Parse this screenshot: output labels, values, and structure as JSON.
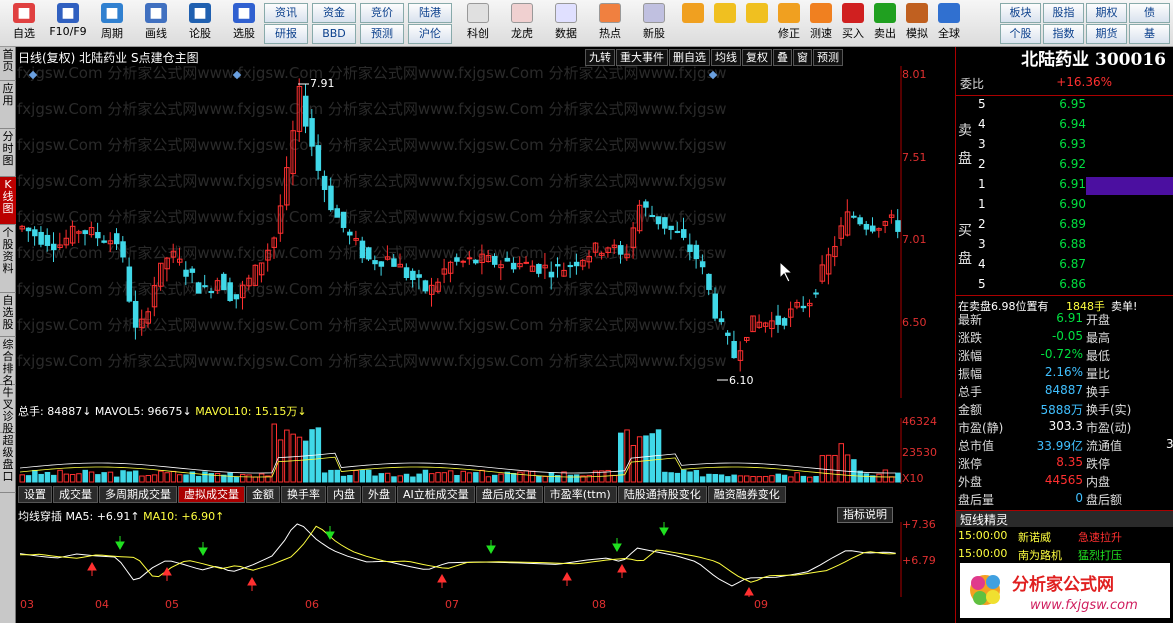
{
  "toolbar": {
    "items": [
      {
        "label": "自选",
        "icon": "star-icon"
      },
      {
        "label": "F10/F9",
        "icon": "f10-icon"
      },
      {
        "label": "周期",
        "icon": "clock-icon"
      },
      {
        "label": "画线",
        "icon": "pencil-icon"
      },
      {
        "label": "论股",
        "icon": "forum-icon"
      },
      {
        "label": "选股",
        "icon": "chart-select-icon"
      }
    ],
    "mid_buttons": [
      [
        "资讯",
        "资金",
        "竞价",
        "陆港"
      ],
      [
        "研报",
        "BBD",
        "预测",
        "沪伦"
      ]
    ],
    "items2": [
      {
        "label": "科创",
        "icon": "kechuang-icon"
      },
      {
        "label": "龙虎",
        "icon": "dragon-tiger-icon"
      },
      {
        "label": "数据",
        "icon": "pe-data-icon"
      },
      {
        "label": "热点",
        "icon": "hot-icon"
      },
      {
        "label": "新股",
        "icon": "ipo-icon"
      }
    ],
    "items3": [
      {
        "label": "",
        "icon": "windows-icon"
      },
      {
        "label": "",
        "icon": "back-arrow-icon"
      },
      {
        "label": "",
        "icon": "up-arrow-icon"
      },
      {
        "label": "修正",
        "icon": "fix-icon"
      },
      {
        "label": "测速",
        "icon": "speed-icon"
      },
      {
        "label": "买入",
        "icon": "buy-icon"
      },
      {
        "label": "卖出",
        "icon": "sell-icon"
      },
      {
        "label": "模拟",
        "icon": "hammer-icon"
      },
      {
        "label": "全球",
        "icon": "globe-icon"
      }
    ],
    "right_buttons": [
      [
        "板块",
        "股指",
        "期权",
        "债"
      ],
      [
        "个股",
        "指数",
        "期货",
        "基"
      ]
    ]
  },
  "left_tabs": [
    "首页",
    "应用",
    "分时图",
    "K线图",
    "个股资料",
    "自选股",
    "综合排名",
    "牛叉诊股",
    "超级盘口"
  ],
  "chart": {
    "title": "日线(复权)  北陆药业  S点建仓主图",
    "buttons": [
      "九转",
      "重大事件",
      "删自选",
      "均线",
      "复权",
      "叠",
      "窗",
      "预测"
    ],
    "price_axis": [
      "8.01",
      "7.51",
      "7.01",
      "6.50"
    ],
    "high_label": "7.91",
    "low_label": "6.10",
    "vol_axis": [
      "46324",
      "23530",
      "X10"
    ],
    "vol_legend": {
      "total": "总手: 84887↓",
      "ma5": "MAVOL5: 96675↓",
      "ma10": "MAVOL10: 15.15万↓"
    },
    "ind_tabs": [
      "设置",
      "成交量",
      "多周期成交量",
      "虚拟成交量",
      "金额",
      "换手率",
      "内盘",
      "外盘",
      "AI立桩成交量",
      "盘后成交量",
      "市盈率(ttm)",
      "陆股通持股变化",
      "融资融券变化"
    ],
    "ma_legend": {
      "name": "均线穿插",
      "ma5": "MA5: +6.91↑",
      "ma10": "MA10: +6.90↑"
    },
    "ind_button": "指标说明",
    "ma_axis": [
      "+7.36",
      "+6.79"
    ],
    "dates": [
      "03",
      "04",
      "05",
      "06",
      "07",
      "08",
      "09"
    ],
    "watermark": "fxjgsw.Com  分析家公式网www.fxjgsw.Com 分析家公式网www.fxjgsw.Com  分析家公式网www.fxjgsw"
  },
  "panel": {
    "name": "北陆药业 300016",
    "weibi_label": "委比",
    "weibi": "+16.36%",
    "sell_side": "卖盘",
    "buy_side": "买盘",
    "asks": [
      [
        "5",
        "6.95"
      ],
      [
        "4",
        "6.94"
      ],
      [
        "3",
        "6.93"
      ],
      [
        "2",
        "6.92"
      ],
      [
        "1",
        "6.91"
      ]
    ],
    "bids": [
      [
        "1",
        "6.90"
      ],
      [
        "2",
        "6.89"
      ],
      [
        "3",
        "6.88"
      ],
      [
        "4",
        "6.87"
      ],
      [
        "5",
        "6.86"
      ]
    ],
    "msg": "在卖盘6.98位置有",
    "msg_qty": "1848手",
    "msg_tail": "卖单!",
    "stats": [
      [
        "最新",
        "6.91",
        "开盘",
        ""
      ],
      [
        "涨跌",
        "-0.05",
        "最高",
        ""
      ],
      [
        "涨幅",
        "-0.72%",
        "最低",
        ""
      ],
      [
        "振幅",
        "2.16%",
        "量比",
        ""
      ],
      [
        "总手",
        "84887",
        "换手",
        ""
      ],
      [
        "金额",
        "5888万",
        "换手(实)",
        ""
      ],
      [
        "市盈(静)",
        "303.3",
        "市盈(动)",
        ""
      ],
      [
        "总市值",
        "33.99亿",
        "流通值",
        "3"
      ],
      [
        "涨停",
        "8.35",
        "跌停",
        ""
      ],
      [
        "外盘",
        "44565",
        "内盘",
        ""
      ],
      [
        "盘后量",
        "0",
        "盘后额",
        ""
      ]
    ],
    "short_title": "短线精灵",
    "short_items": [
      [
        "15:00:00",
        "新诺威",
        "急速拉升"
      ],
      [
        "15:00:00",
        "南为路机",
        "猛烈打压"
      ]
    ],
    "logo_text": "分析家公式网",
    "logo_url": "www.fxjgsw.com"
  },
  "colors": {
    "up": "#ff3030",
    "down": "#40d8e8",
    "ma5": "#ffffff",
    "ma10": "#ffff40"
  }
}
